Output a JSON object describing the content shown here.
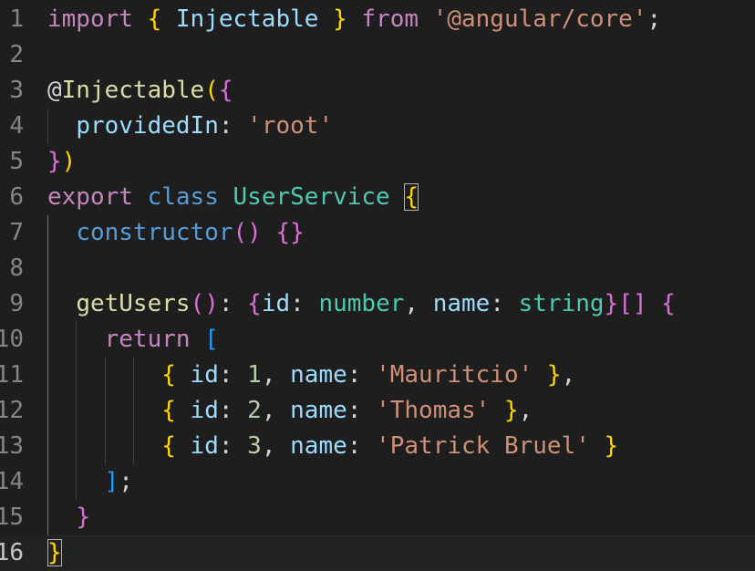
{
  "editor": {
    "active_line": 16,
    "colors": {
      "background": "#1e1e1e",
      "keyword": "#c586c0",
      "storage": "#569cd6",
      "function": "#dcdcaa",
      "variable": "#9cdcfe",
      "type": "#4ec9b0",
      "string": "#ce9178",
      "number": "#b5cea8",
      "bracket_1": "#ffd700",
      "bracket_2": "#da70d6",
      "bracket_3": "#179fff"
    },
    "lines": [
      {
        "n": "1",
        "tokens": [
          [
            "import",
            "k-kw"
          ],
          [
            " ",
            ""
          ],
          [
            "{",
            "b1"
          ],
          [
            " ",
            ""
          ],
          [
            "Injectable",
            "k-var"
          ],
          [
            " ",
            ""
          ],
          [
            "}",
            "b1"
          ],
          [
            " ",
            ""
          ],
          [
            "from",
            "k-kw"
          ],
          [
            " ",
            ""
          ],
          [
            "'@angular/core'",
            "k-str"
          ],
          [
            ";",
            "k-p"
          ]
        ]
      },
      {
        "n": "2",
        "tokens": []
      },
      {
        "n": "3",
        "tokens": [
          [
            "@",
            "k-p"
          ],
          [
            "Injectable",
            "k-dec"
          ],
          [
            "(",
            "b1"
          ],
          [
            "{",
            "b2"
          ]
        ]
      },
      {
        "n": "4",
        "tokens": [
          [
            "  ",
            ""
          ],
          [
            "providedIn",
            "k-var"
          ],
          [
            ": ",
            "k-p"
          ],
          [
            "'root'",
            "k-str"
          ]
        ]
      },
      {
        "n": "5",
        "tokens": [
          [
            "}",
            "b2"
          ],
          [
            ")",
            "b1"
          ]
        ]
      },
      {
        "n": "6",
        "tokens": [
          [
            "export",
            "k-kw"
          ],
          [
            " ",
            ""
          ],
          [
            "class",
            "k-kw2"
          ],
          [
            " ",
            ""
          ],
          [
            "UserService",
            "k-type"
          ],
          [
            " ",
            ""
          ],
          [
            "{",
            "b1 bm"
          ]
        ]
      },
      {
        "n": "7",
        "tokens": [
          [
            "  ",
            ""
          ],
          [
            "constructor",
            "k-kw2"
          ],
          [
            "()",
            "b2"
          ],
          [
            " ",
            ""
          ],
          [
            "{}",
            "b2"
          ]
        ]
      },
      {
        "n": "8",
        "tokens": []
      },
      {
        "n": "9",
        "tokens": [
          [
            "  ",
            ""
          ],
          [
            "getUsers",
            "k-fn"
          ],
          [
            "()",
            "b2"
          ],
          [
            ": ",
            "k-p"
          ],
          [
            "{",
            "b2"
          ],
          [
            "id",
            "k-var"
          ],
          [
            ": ",
            "k-p"
          ],
          [
            "number",
            "k-type"
          ],
          [
            ", ",
            "k-p"
          ],
          [
            "name",
            "k-var"
          ],
          [
            ": ",
            "k-p"
          ],
          [
            "string",
            "k-type"
          ],
          [
            "}",
            "b2"
          ],
          [
            "[]",
            "b2"
          ],
          [
            " ",
            ""
          ],
          [
            "{",
            "b2"
          ]
        ]
      },
      {
        "n": "10",
        "tokens": [
          [
            "    ",
            ""
          ],
          [
            "return",
            "k-kw"
          ],
          [
            " ",
            ""
          ],
          [
            "[",
            "b3"
          ]
        ]
      },
      {
        "n": "11",
        "tokens": [
          [
            "        ",
            ""
          ],
          [
            "{",
            "b1"
          ],
          [
            " ",
            ""
          ],
          [
            "id",
            "k-var"
          ],
          [
            ": ",
            "k-p"
          ],
          [
            "1",
            "k-num"
          ],
          [
            ", ",
            "k-p"
          ],
          [
            "name",
            "k-var"
          ],
          [
            ": ",
            "k-p"
          ],
          [
            "'Mauritcio'",
            "k-str"
          ],
          [
            " ",
            ""
          ],
          [
            "}",
            "b1"
          ],
          [
            ",",
            "k-p"
          ]
        ]
      },
      {
        "n": "12",
        "tokens": [
          [
            "        ",
            ""
          ],
          [
            "{",
            "b1"
          ],
          [
            " ",
            ""
          ],
          [
            "id",
            "k-var"
          ],
          [
            ": ",
            "k-p"
          ],
          [
            "2",
            "k-num"
          ],
          [
            ", ",
            "k-p"
          ],
          [
            "name",
            "k-var"
          ],
          [
            ": ",
            "k-p"
          ],
          [
            "'Thomas'",
            "k-str"
          ],
          [
            " ",
            ""
          ],
          [
            "}",
            "b1"
          ],
          [
            ",",
            "k-p"
          ]
        ]
      },
      {
        "n": "13",
        "tokens": [
          [
            "        ",
            ""
          ],
          [
            "{",
            "b1"
          ],
          [
            " ",
            ""
          ],
          [
            "id",
            "k-var"
          ],
          [
            ": ",
            "k-p"
          ],
          [
            "3",
            "k-num"
          ],
          [
            ", ",
            "k-p"
          ],
          [
            "name",
            "k-var"
          ],
          [
            ": ",
            "k-p"
          ],
          [
            "'Patrick Bruel'",
            "k-str"
          ],
          [
            " ",
            ""
          ],
          [
            "}",
            "b1"
          ]
        ]
      },
      {
        "n": "14",
        "tokens": [
          [
            "    ",
            ""
          ],
          [
            "]",
            "b3"
          ],
          [
            ";",
            "k-p"
          ]
        ]
      },
      {
        "n": "15",
        "tokens": [
          [
            "  ",
            ""
          ],
          [
            "}",
            "b2"
          ]
        ]
      },
      {
        "n": "16",
        "tokens": [
          [
            "}",
            "b1 bm"
          ]
        ]
      }
    ]
  }
}
